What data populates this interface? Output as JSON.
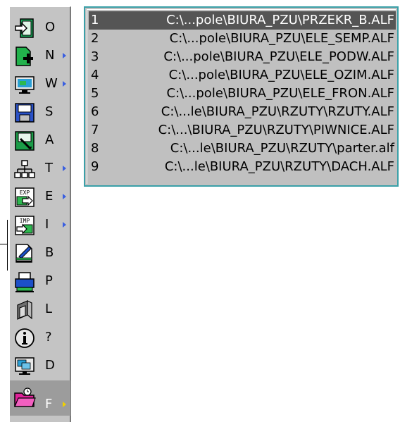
{
  "menu": {
    "items": [
      {
        "label": "O",
        "icon": "open-icon",
        "has_submenu": false
      },
      {
        "label": "N",
        "icon": "new-icon",
        "has_submenu": true
      },
      {
        "label": "W",
        "icon": "window-icon",
        "has_submenu": true
      },
      {
        "label": "S",
        "icon": "save-icon",
        "has_submenu": false
      },
      {
        "label": "A",
        "icon": "save-as-icon",
        "has_submenu": false
      },
      {
        "label": "T",
        "icon": "tree-icon",
        "has_submenu": true
      },
      {
        "label": "E",
        "icon": "export-icon",
        "has_submenu": true
      },
      {
        "label": "I",
        "icon": "import-icon",
        "has_submenu": true
      },
      {
        "label": "B",
        "icon": "edit-icon",
        "has_submenu": false
      },
      {
        "label": "P",
        "icon": "print-icon",
        "has_submenu": false
      },
      {
        "label": "L",
        "icon": "layout-icon",
        "has_submenu": false
      },
      {
        "label": "?",
        "icon": "info-icon",
        "has_submenu": false
      },
      {
        "label": "D",
        "icon": "desktop-icon",
        "has_submenu": false
      },
      {
        "label": "F",
        "icon": "recent-folder-icon",
        "has_submenu": true,
        "active": true
      }
    ],
    "exp_text": "EXP",
    "imp_text": "IMP"
  },
  "recent_files": [
    {
      "num": "1",
      "path": "C:\\...pole\\BIURA_PZU\\PRZEKR_B.ALF"
    },
    {
      "num": "2",
      "path": "C:\\...pole\\BIURA_PZU\\ELE_SEMP.ALF"
    },
    {
      "num": "3",
      "path": "C:\\...pole\\BIURA_PZU\\ELE_PODW.ALF"
    },
    {
      "num": "4",
      "path": "C:\\...pole\\BIURA_PZU\\ELE_OZIM.ALF"
    },
    {
      "num": "5",
      "path": "C:\\...pole\\BIURA_PZU\\ELE_FRON.ALF"
    },
    {
      "num": "6",
      "path": "C:\\...le\\BIURA_PZU\\RZUTY\\RZUTY.ALF"
    },
    {
      "num": "7",
      "path": "C:\\...\\BIURA_PZU\\RZUTY\\PIWNICE.ALF"
    },
    {
      "num": "8",
      "path": "C:\\...le\\BIURA_PZU\\RZUTY\\parter.alf"
    },
    {
      "num": "9",
      "path": "C:\\...le\\BIURA_PZU\\RZUTY\\DACH.ALF"
    }
  ],
  "colors": {
    "menu_bg": "#c4c4c4",
    "active_bg": "#9c9c9c",
    "selected_row": "#555555",
    "panel_border": "#3aa0a8",
    "submenu_arrow": "#3a5fe0",
    "active_arrow": "#f0d000"
  }
}
